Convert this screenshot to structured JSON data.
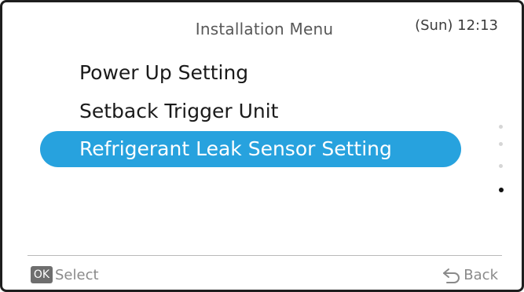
{
  "header": {
    "title": "Installation Menu",
    "time": "(Sun) 12:13"
  },
  "menu": {
    "items": [
      {
        "label": "Power Up Setting",
        "selected": false
      },
      {
        "label": "Setback Trigger Unit",
        "selected": false
      },
      {
        "label": "Refrigerant Leak Sensor Setting",
        "selected": true
      }
    ],
    "scroll_position": "4 of 4"
  },
  "footer": {
    "ok_badge": "OK",
    "select_label": "Select",
    "back_icon": "back-arrow-icon",
    "back_label": "Back"
  },
  "colors": {
    "selection_bg": "#27a2de",
    "selection_text": "#ffffff",
    "bezel": "#1e1e1e"
  }
}
